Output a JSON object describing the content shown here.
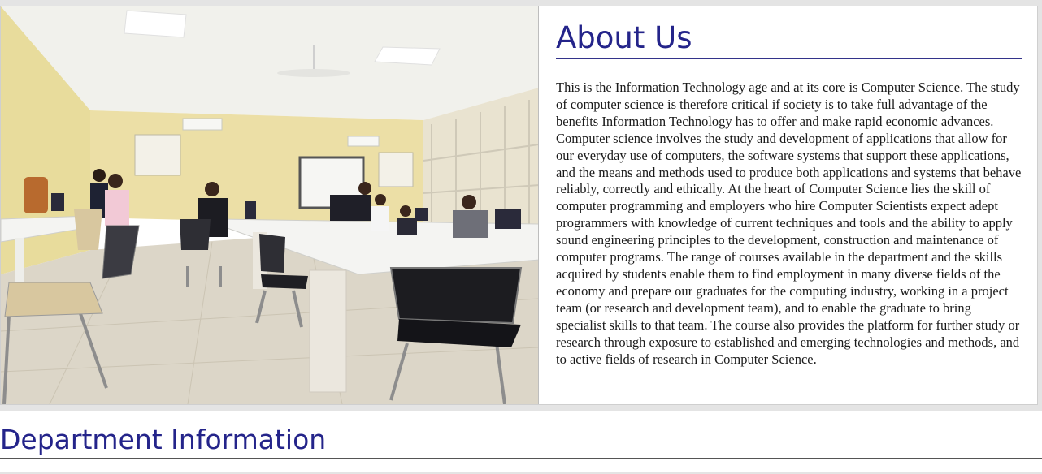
{
  "about": {
    "title": "About Us",
    "body": "This is the Information Technology age and at its core is Computer Science. The study of computer science is therefore critical if society is to take full advantage of the benefits Information Technology has to offer and make rapid economic advances. Computer science involves the study and development of applications that allow for our everyday use of computers, the software systems that support these applications, and the means and methods used to produce both applications and systems that behave reliably, correctly and ethically. At the heart of Computer Science lies the skill of computer programming and employers who hire Computer Scientists expect adept programmers with knowledge of current techniques and tools and the ability to apply sound engineering principles to the development, construction and maintenance of computer programs. The range of courses available in the department and the skills acquired by students enable them to find employment in many diverse fields of the economy and prepare our graduates for the computing industry, working in a project team (or research and development team), and to enable the graduate to bring specialist skills to that team. The course also provides the platform for further study or research through exposure to established and emerging technologies and methods, and to active fields of research in Computer Science."
  },
  "department": {
    "title": "Department Information"
  },
  "colors": {
    "heading": "#24248a",
    "wall": "#ecdfa6",
    "ceiling": "#f2f2ee",
    "floor": "#dcd6c8",
    "desk": "#f4f4f2"
  }
}
